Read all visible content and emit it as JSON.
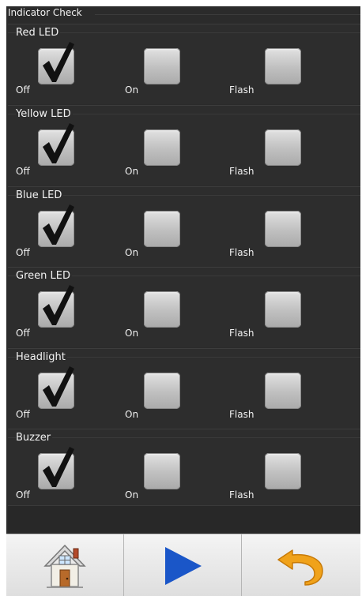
{
  "panel": {
    "title": "Indicator Check"
  },
  "groups": [
    {
      "title": "Red LED",
      "options": [
        {
          "label": "Off",
          "checked": true
        },
        {
          "label": "On",
          "checked": false
        },
        {
          "label": "Flash",
          "checked": false
        }
      ]
    },
    {
      "title": "Yellow LED",
      "options": [
        {
          "label": "Off",
          "checked": true
        },
        {
          "label": "On",
          "checked": false
        },
        {
          "label": "Flash",
          "checked": false
        }
      ]
    },
    {
      "title": "Blue LED",
      "options": [
        {
          "label": "Off",
          "checked": true
        },
        {
          "label": "On",
          "checked": false
        },
        {
          "label": "Flash",
          "checked": false
        }
      ]
    },
    {
      "title": "Green LED",
      "options": [
        {
          "label": "Off",
          "checked": true
        },
        {
          "label": "On",
          "checked": false
        },
        {
          "label": "Flash",
          "checked": false
        }
      ]
    },
    {
      "title": "Headlight",
      "options": [
        {
          "label": "Off",
          "checked": true
        },
        {
          "label": "On",
          "checked": false
        },
        {
          "label": "Flash",
          "checked": false
        }
      ]
    },
    {
      "title": "Buzzer",
      "options": [
        {
          "label": "Off",
          "checked": true
        },
        {
          "label": "On",
          "checked": false
        },
        {
          "label": "Flash",
          "checked": false
        }
      ]
    }
  ],
  "toolbar": {
    "buttons": [
      {
        "icon": "home-icon"
      },
      {
        "icon": "play-icon"
      },
      {
        "icon": "undo-icon"
      }
    ]
  },
  "colors": {
    "panel_bg": "#2b2b2b",
    "text": "#f2f2f2",
    "play_blue": "#1a56c8",
    "undo_orange": "#f0a21a"
  }
}
